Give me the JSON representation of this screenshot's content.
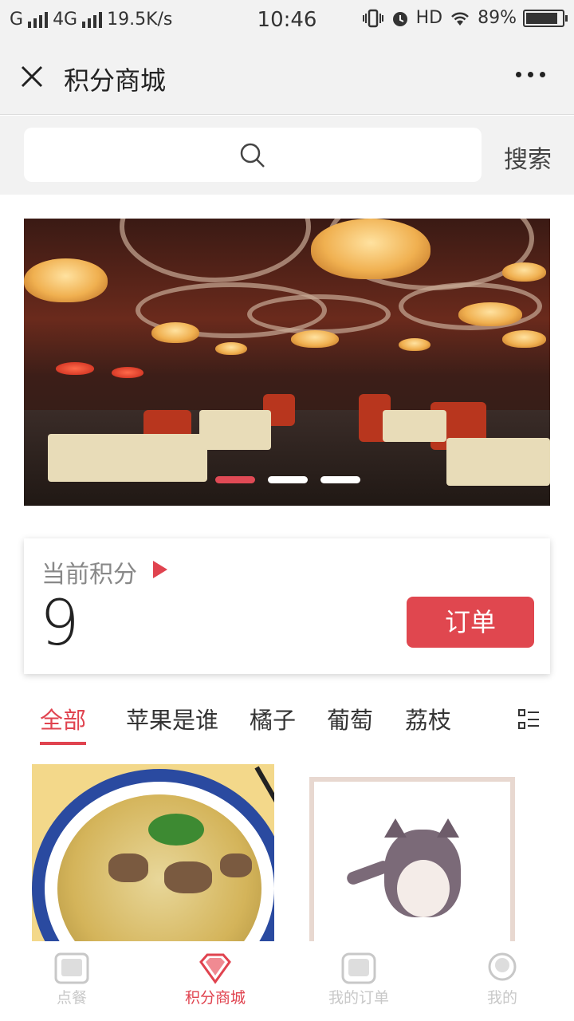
{
  "status": {
    "carrier1": "G",
    "carrier2": "4G",
    "speed": "19.5K/s",
    "time": "10:46",
    "hd": "HD",
    "battery": "89%",
    "battery_level": 0.89
  },
  "titlebar": {
    "title": "积分商城",
    "close_icon": "close-icon",
    "more_icon": "more-dots-icon"
  },
  "search": {
    "placeholder": "",
    "button_label": "搜索"
  },
  "banner": {
    "slide_count": 3,
    "active_index": 0,
    "accent": "#e04a55"
  },
  "points": {
    "label": "当前积分",
    "value": "9",
    "order_button": "订单"
  },
  "tabs": {
    "items": [
      "全部",
      "苹果是谁",
      "橘子",
      "葡萄",
      "荔枝"
    ],
    "active_index": 0
  },
  "nav": {
    "items": [
      {
        "label": "点餐",
        "icon": "order-food-icon"
      },
      {
        "label": "积分商城",
        "icon": "diamond-icon"
      },
      {
        "label": "我的订单",
        "icon": "orders-icon"
      },
      {
        "label": "我的",
        "icon": "profile-icon"
      }
    ],
    "active_index": 1
  },
  "colors": {
    "accent": "#e0434f",
    "background": "#f2f2f2"
  }
}
